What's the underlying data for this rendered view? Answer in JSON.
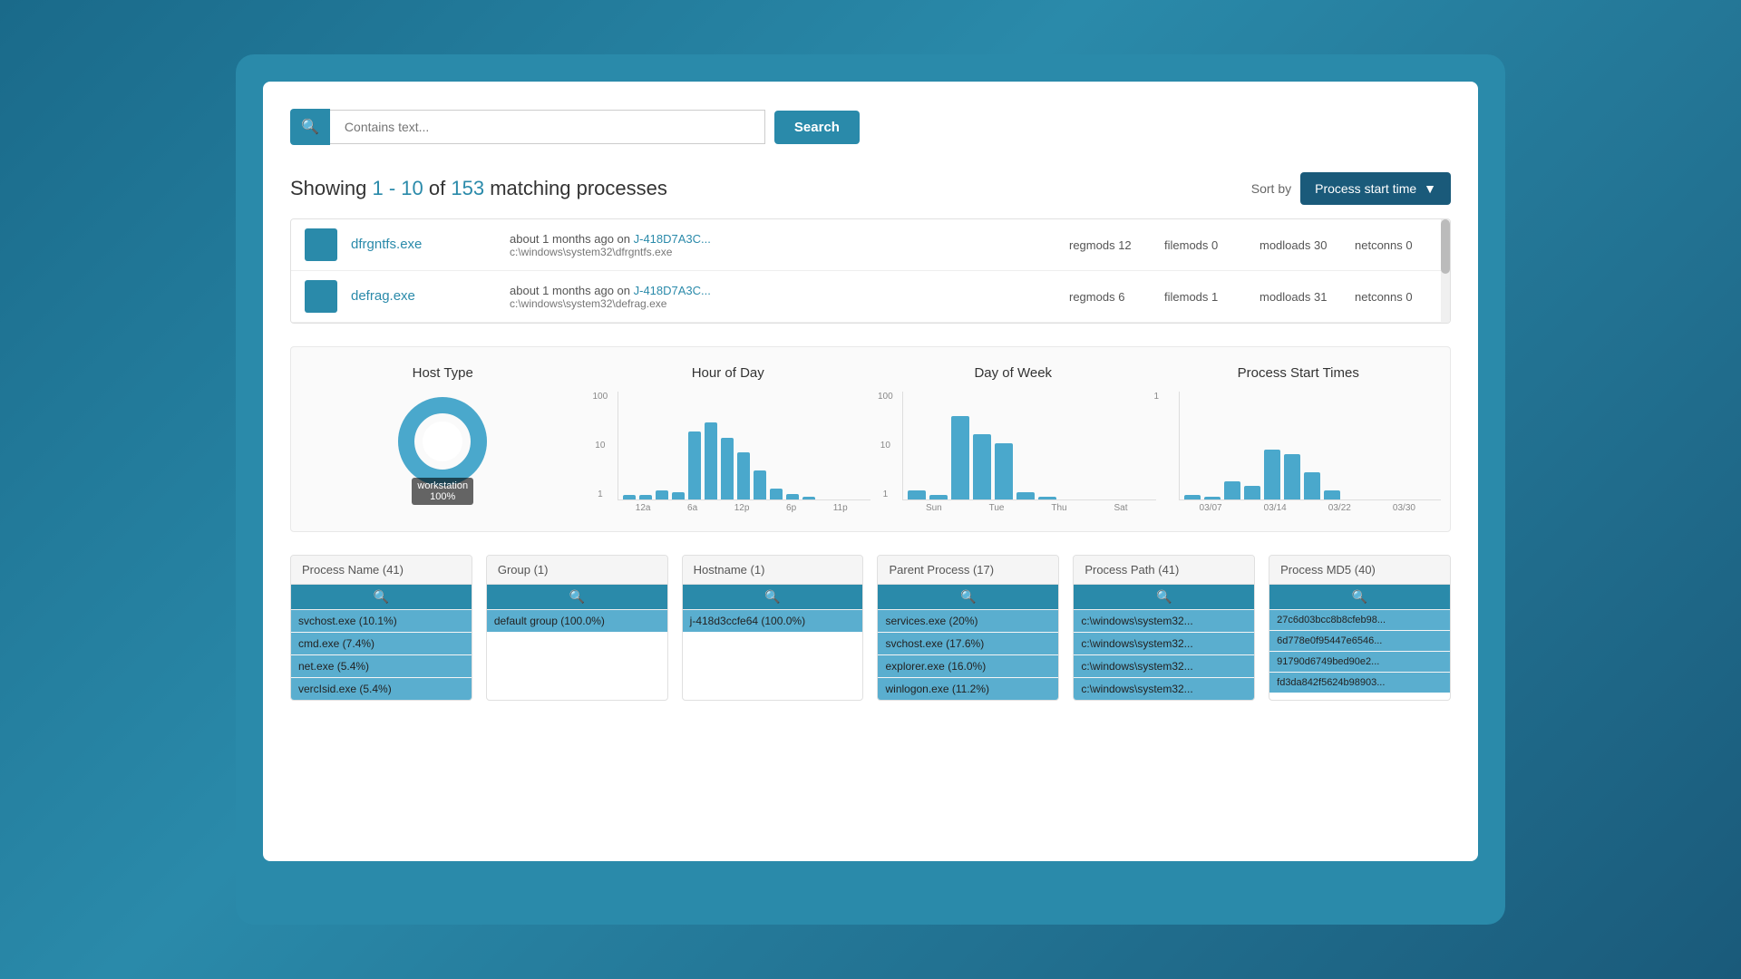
{
  "search": {
    "placeholder": "Contains text...",
    "button_label": "Search"
  },
  "results": {
    "showing_text": "Showing",
    "range": "1 - 10",
    "of_text": "of",
    "count": "153",
    "suffix": "matching processes",
    "sort_label": "Sort by",
    "sort_value": "Process start time"
  },
  "processes": [
    {
      "name": "dfrgntfs.exe",
      "time": "about 1 months ago on",
      "host_link": "J-418D7A3C...",
      "path": "c:\\windows\\system32\\dfrgntfs.exe",
      "regmods": "regmods 12",
      "filemods": "filemods 0",
      "modloads": "modloads 30",
      "netconns": "netconns 0"
    },
    {
      "name": "defrag.exe",
      "time": "about 1 months ago on",
      "host_link": "J-418D7A3C...",
      "path": "c:\\windows\\system32\\defrag.exe",
      "regmods": "regmods 6",
      "filemods": "filemods 1",
      "modloads": "modloads 31",
      "netconns": "netconns 0"
    }
  ],
  "charts": {
    "host_type": {
      "title": "Host Type",
      "label": "workstation\n100%"
    },
    "hour_of_day": {
      "title": "Hour of Day",
      "y_labels": [
        "100",
        "10",
        "1"
      ],
      "x_labels": [
        "12a",
        "6a",
        "12p",
        "6p",
        "11p"
      ],
      "bars": [
        0,
        5,
        10,
        8,
        70,
        80,
        65,
        50,
        30,
        10,
        5,
        3
      ]
    },
    "day_of_week": {
      "title": "Day of Week",
      "y_labels": [
        "100",
        "10",
        "1"
      ],
      "x_labels": [
        "Sun",
        "Tue",
        "Thu",
        "Sat"
      ],
      "bars": [
        10,
        5,
        90,
        70,
        60,
        8,
        3
      ]
    },
    "process_start_times": {
      "title": "Process Start Times",
      "y_labels": [
        "1"
      ],
      "x_labels": [
        "03/07",
        "03/14",
        "03/22",
        "03/30"
      ],
      "bars": [
        5,
        3,
        20,
        15,
        55,
        50,
        30,
        10
      ]
    }
  },
  "filters": {
    "process_name": {
      "header": "Process Name (41)",
      "items": [
        "svchost.exe (10.1%)",
        "cmd.exe (7.4%)",
        "net.exe (5.4%)",
        "vercIsid.exe (5.4%)"
      ]
    },
    "group": {
      "header": "Group (1)",
      "items": [
        "default group (100.0%)"
      ]
    },
    "hostname": {
      "header": "Hostname (1)",
      "items": [
        "j-418d3ccfe64 (100.0%)"
      ]
    },
    "parent_process": {
      "header": "Parent Process (17)",
      "items": [
        "services.exe (20%)",
        "svchost.exe (17.6%)",
        "explorer.exe (16.0%)",
        "winlogon.exe (11.2%)"
      ]
    },
    "process_path": {
      "header": "Process Path (41)",
      "items": [
        "c:\\windows\\system32...",
        "c:\\windows\\system32...",
        "c:\\windows\\system32...",
        "c:\\windows\\system32..."
      ]
    },
    "process_md5": {
      "header": "Process MD5 (40)",
      "items": [
        "27c6d03bcc8b8cfeb98...",
        "6d778e0f95447e6546...",
        "91790d6749bed90e2...",
        "fd3da842f5624b98903..."
      ]
    }
  }
}
